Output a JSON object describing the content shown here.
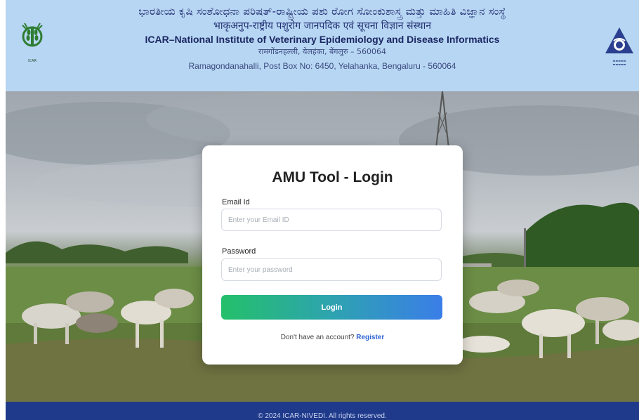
{
  "header": {
    "line_kannada": "ಭಾರತೀಯ ಕೃಷಿ ಸಂಶೋಧನಾ ಪರಿಷತ್-ರಾಷ್ಟ್ರೀಯ ಪಶು ರೋಗ ಸೋಂಕುಶಾಸ್ತ್ರ ಮತ್ತು ಮಾಹಿತಿ ವಿಜ್ಞಾನ ಸಂಸ್ಥೆ",
    "line_hindi": "भाकृअनुप-राष्ट्रीय पशुरोग जानपदिक एवं सूचना विज्ञान संस्थान",
    "line_english": "ICAR–National Institute of Veterinary Epidemiology and Disease Informatics",
    "address_hindi": "रामगोंडनहल्ली, येलहंका, बेंगलुरु – 560064",
    "address_english": "Ramagondanahalli, Post Box No: 6450, Yelahanka, Bengaluru - 560064",
    "logo_left_caption": "ICAR",
    "colors": {
      "background": "#b7d6f3",
      "text": "#1f2d70"
    }
  },
  "login": {
    "title": "AMU Tool - Login",
    "email_label": "Email Id",
    "email_placeholder": "Enter your Email ID",
    "email_value": "",
    "password_label": "Password",
    "password_placeholder": "Enter your password",
    "password_value": "",
    "login_button": "Login",
    "register_prompt": "Don't have an account?",
    "register_link": "Register",
    "colors": {
      "button_start": "#24c06a",
      "button_end": "#3a7ee8",
      "link": "#2f63d6"
    }
  },
  "footer": {
    "text": "© 2024 ICAR-NIVEDI. All rights reserved.",
    "color": "#1f3a8a"
  }
}
